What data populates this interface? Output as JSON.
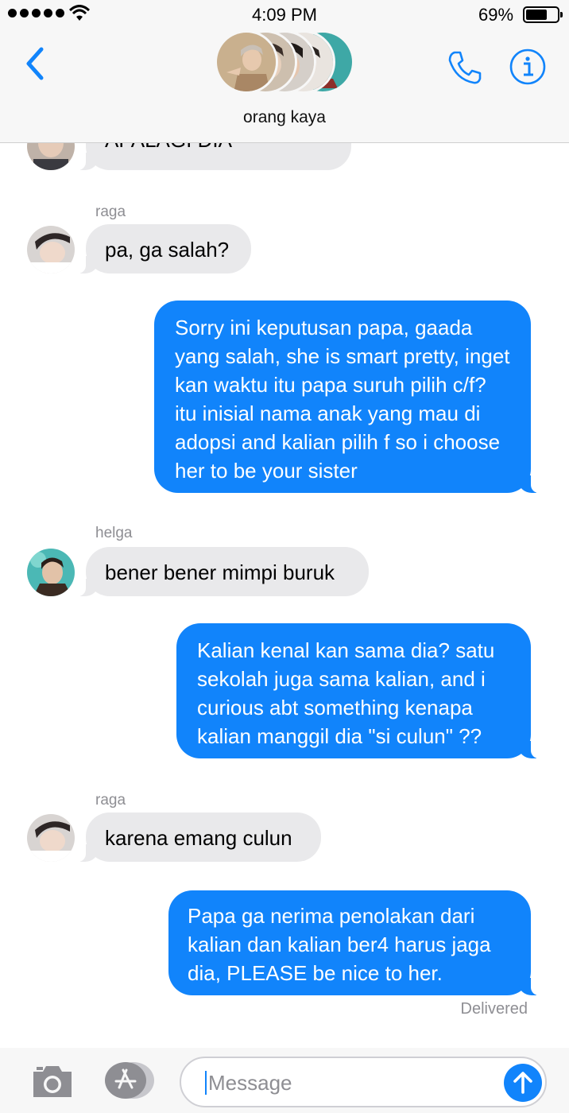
{
  "status_bar": {
    "time": "4:09 PM",
    "battery_percent": "69%",
    "battery_level": 0.69,
    "signal_bars": 5
  },
  "header": {
    "group_name": "orang kaya"
  },
  "messages": [
    {
      "text": "APALAGI DIA"
    },
    {
      "sender": "raga",
      "text": "pa, ga salah?"
    },
    {
      "text": "Sorry ini keputusan papa, gaada yang salah, she is smart pretty, inget kan waktu itu papa suruh pilih c/f? itu inisial nama anak yang mau di adopsi and kalian pilih f so i choose her to be your sister"
    },
    {
      "sender": "helga",
      "text": "bener bener mimpi buruk"
    },
    {
      "text": "Kalian kenal kan sama dia? satu sekolah juga sama kalian, and i curious abt something kenapa kalian manggil dia \"si culun\" ??"
    },
    {
      "sender": "raga",
      "text": "karena emang culun"
    },
    {
      "text": "Papa ga nerima penolakan dari kalian dan kalian ber4 harus jaga dia, PLEASE be nice to her."
    }
  ],
  "delivered_label": "Delivered",
  "input": {
    "placeholder": "Message"
  },
  "colors": {
    "accent": "#1184fb",
    "incoming_bubble": "#e9e9eb",
    "bar_background": "#f7f7f7",
    "meta_text": "#8e8e93"
  },
  "icons": [
    "back-chevron-icon",
    "phone-icon",
    "info-icon",
    "camera-icon",
    "app-store-icon",
    "send-arrow-icon",
    "wifi-icon"
  ]
}
